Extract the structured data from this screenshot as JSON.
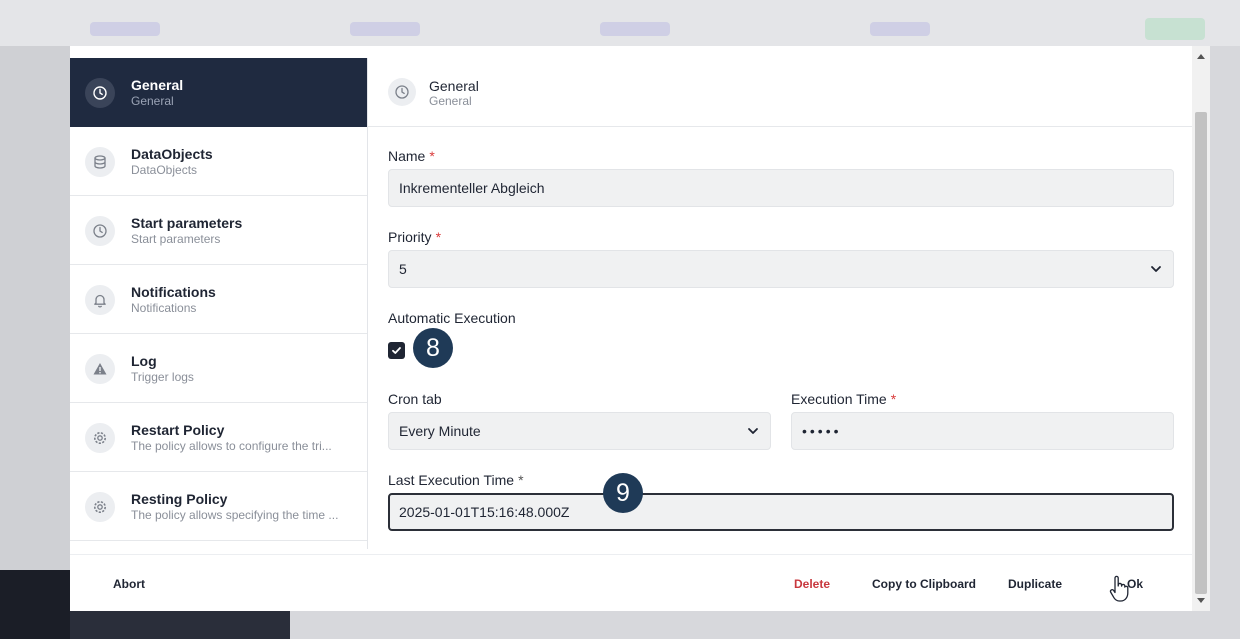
{
  "sidebar": {
    "items": [
      {
        "title": "General",
        "subtitle": "General",
        "icon": "clock-icon"
      },
      {
        "title": "DataObjects",
        "subtitle": "DataObjects",
        "icon": "database-icon"
      },
      {
        "title": "Start parameters",
        "subtitle": "Start parameters",
        "icon": "clock-icon"
      },
      {
        "title": "Notifications",
        "subtitle": "Notifications",
        "icon": "bell-icon"
      },
      {
        "title": "Log",
        "subtitle": "Trigger logs",
        "icon": "warning-icon"
      },
      {
        "title": "Restart Policy",
        "subtitle": "The policy allows to configure the tri...",
        "icon": "gear-icon"
      },
      {
        "title": "Resting Policy",
        "subtitle": "The policy allows specifying the time ...",
        "icon": "gear-icon"
      }
    ]
  },
  "header": {
    "title": "General",
    "subtitle": "General"
  },
  "form": {
    "name_label": "Name",
    "name_value": "Inkrementeller Abgleich",
    "priority_label": "Priority",
    "priority_value": "5",
    "auto_exec_label": "Automatic Execution",
    "auto_exec_checked": true,
    "cron_label": "Cron tab",
    "cron_value": "Every Minute",
    "exec_time_label": "Execution Time",
    "exec_time_value": "•••••",
    "last_exec_label": "Last Execution Time",
    "last_exec_value": "2025-01-01T15:16:48.000Z",
    "required_mark": "*"
  },
  "markers": {
    "checkbox_marker": "8",
    "last_exec_marker": "9"
  },
  "footer": {
    "abort": "Abort",
    "delete": "Delete",
    "copy": "Copy to Clipboard",
    "duplicate": "Duplicate",
    "ok": "Ok"
  },
  "colors": {
    "accent_dark": "#1f2a40",
    "danger": "#c8383e",
    "marker": "#1f3a57"
  }
}
